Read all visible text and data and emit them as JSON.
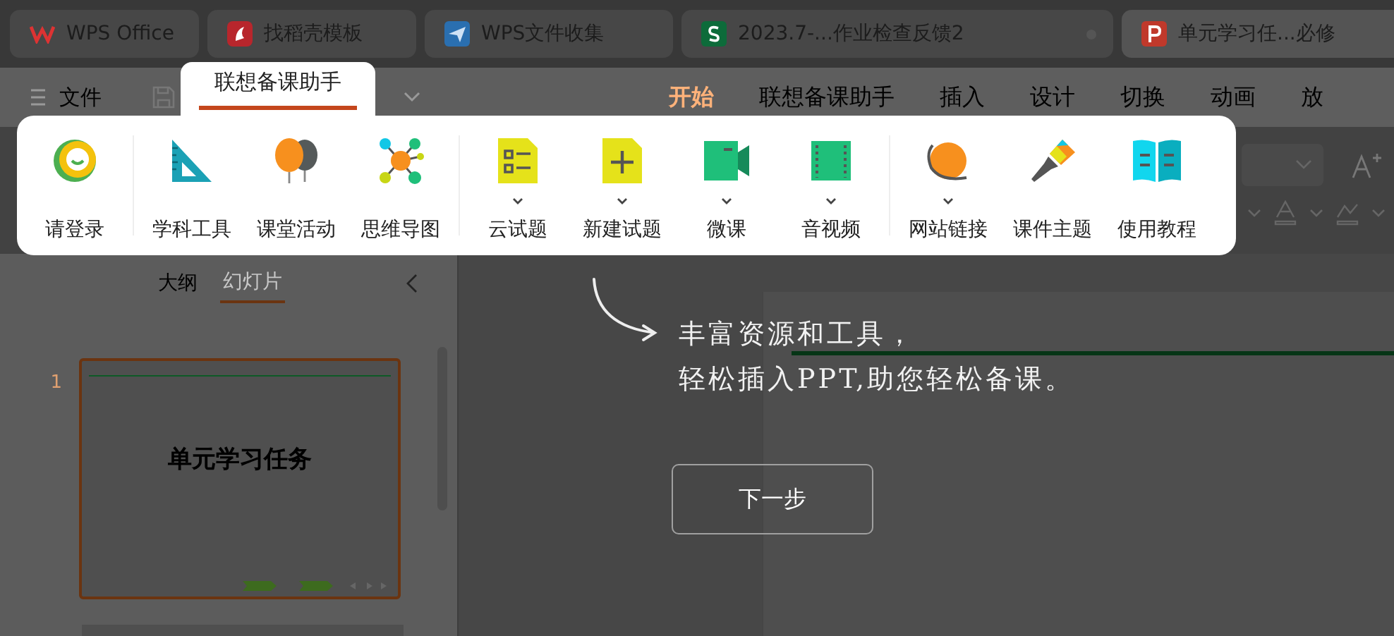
{
  "browser_tabs": [
    {
      "title": "WPS Office",
      "kind": "wps",
      "selected": false,
      "modified": false
    },
    {
      "title": "找稻壳模板",
      "kind": "docer",
      "selected": false,
      "modified": false
    },
    {
      "title": "WPS文件收集",
      "kind": "collect",
      "selected": false,
      "modified": false
    },
    {
      "title": "2023.7-...作业检查反馈2",
      "kind": "sheet",
      "selected": false,
      "modified": true
    },
    {
      "title": "单元学习任...必修",
      "kind": "slides",
      "selected": true,
      "modified": false
    }
  ],
  "file_menu": {
    "label": "文件"
  },
  "highlight_tab": {
    "label": "联想备课助手"
  },
  "ribbon_tabs": [
    {
      "label": "开始",
      "selected": true
    },
    {
      "label": "联想备课助手",
      "selected": false
    },
    {
      "label": "插入",
      "selected": false
    },
    {
      "label": "设计",
      "selected": false
    },
    {
      "label": "切换",
      "selected": false
    },
    {
      "label": "动画",
      "selected": false
    },
    {
      "label": "放",
      "selected": false
    }
  ],
  "assistant_panel": {
    "groups": [
      [
        {
          "label": "请登录",
          "kind": "login",
          "dropdown": false
        }
      ],
      [
        {
          "label": "学科工具",
          "kind": "ruler",
          "dropdown": false
        },
        {
          "label": "课堂活动",
          "kind": "balloons",
          "dropdown": false
        },
        {
          "label": "思维导图",
          "kind": "mindmap",
          "dropdown": false
        }
      ],
      [
        {
          "label": "云试题",
          "kind": "quiz-list",
          "dropdown": true
        },
        {
          "label": "新建试题",
          "kind": "quiz-new",
          "dropdown": true
        },
        {
          "label": "微课",
          "kind": "video",
          "dropdown": true
        },
        {
          "label": "音视频",
          "kind": "film",
          "dropdown": true
        }
      ],
      [
        {
          "label": "网站链接",
          "kind": "planet",
          "dropdown": true
        },
        {
          "label": "课件主题",
          "kind": "brush",
          "dropdown": false
        },
        {
          "label": "使用教程",
          "kind": "book",
          "dropdown": false
        }
      ]
    ]
  },
  "sidebar": {
    "tabs": [
      {
        "label": "大纲",
        "selected": false
      },
      {
        "label": "幻灯片",
        "selected": true
      }
    ],
    "slides": [
      {
        "number": "1",
        "title": "单元学习任务",
        "selected": true
      }
    ]
  },
  "guide": {
    "lines": [
      "丰富资源和工具，",
      "轻松插入PPT,助您轻松备课。"
    ],
    "button": "下一步"
  }
}
